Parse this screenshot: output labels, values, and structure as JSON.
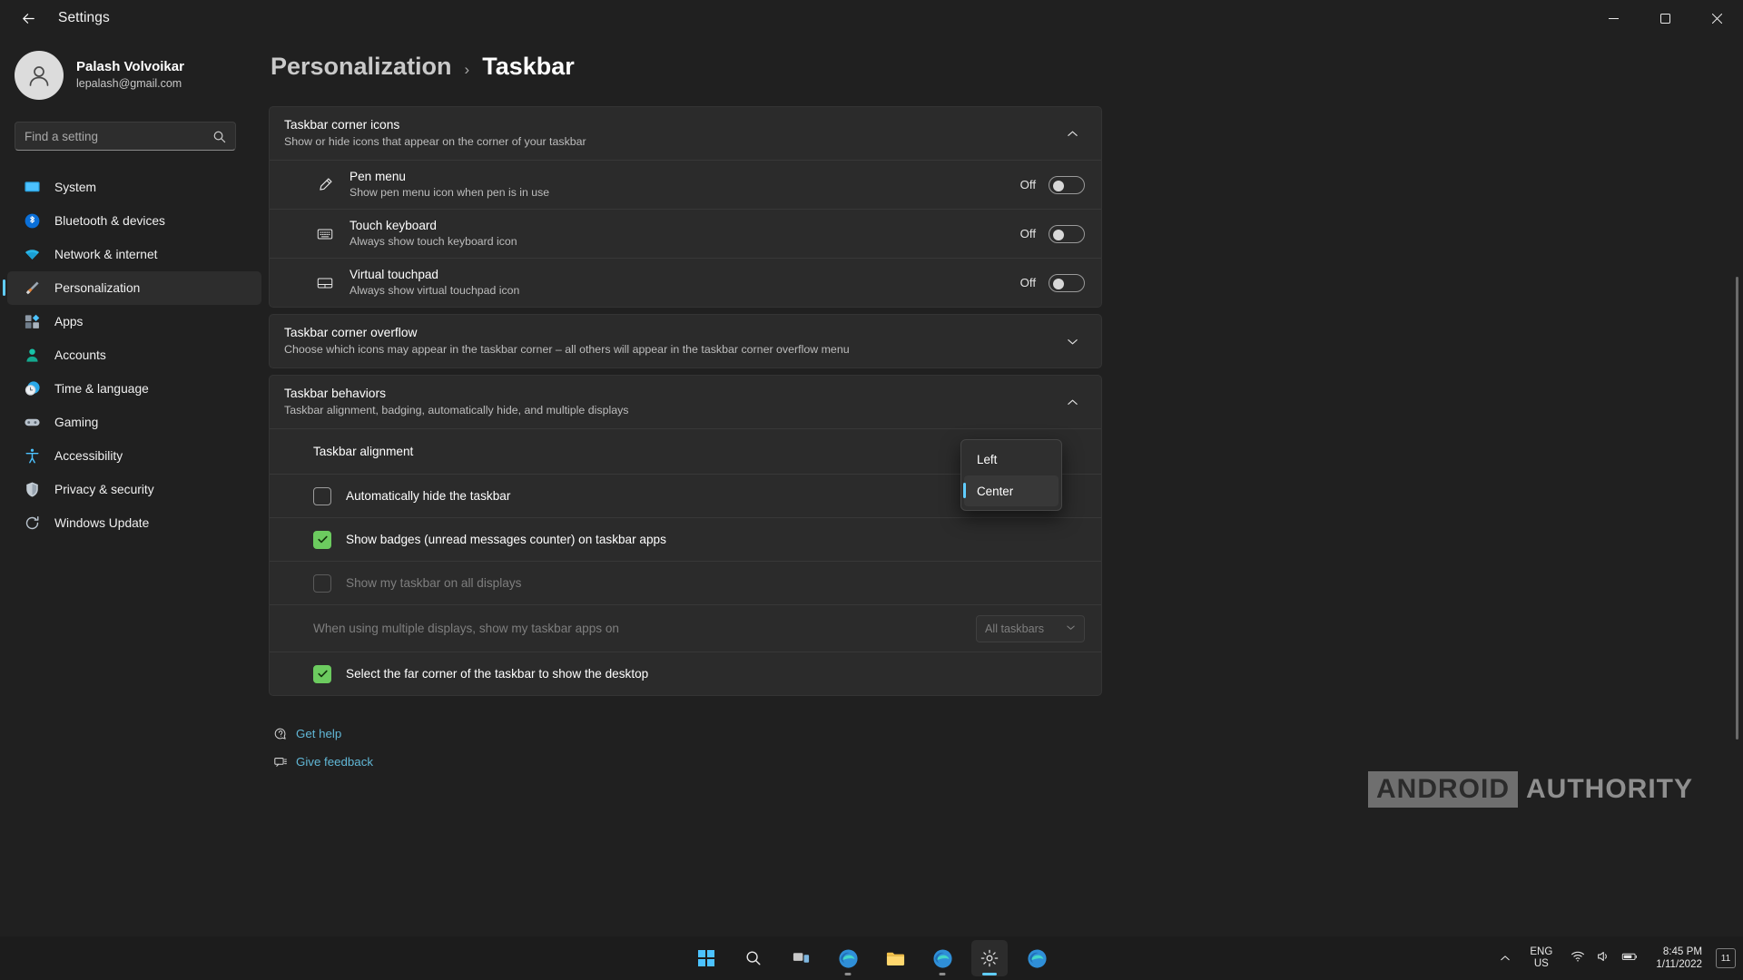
{
  "window": {
    "app_title": "Settings",
    "back_icon": "back-arrow-icon",
    "minimize": "minimize-icon",
    "maximize": "maximize-icon",
    "close": "close-icon"
  },
  "profile": {
    "name": "Palash Volvoikar",
    "email": "lepalash@gmail.com",
    "avatar_icon": "user-avatar-icon"
  },
  "search": {
    "placeholder": "Find a setting",
    "value": "",
    "icon": "search-icon"
  },
  "sidebar": {
    "items": [
      {
        "label": "System",
        "icon": "system-icon",
        "active": false
      },
      {
        "label": "Bluetooth & devices",
        "icon": "bluetooth-icon",
        "active": false
      },
      {
        "label": "Network & internet",
        "icon": "wifi-icon",
        "active": false
      },
      {
        "label": "Personalization",
        "icon": "paintbrush-icon",
        "active": true
      },
      {
        "label": "Apps",
        "icon": "apps-icon",
        "active": false
      },
      {
        "label": "Accounts",
        "icon": "accounts-icon",
        "active": false
      },
      {
        "label": "Time & language",
        "icon": "clock-icon",
        "active": false
      },
      {
        "label": "Gaming",
        "icon": "gamepad-icon",
        "active": false
      },
      {
        "label": "Accessibility",
        "icon": "accessibility-icon",
        "active": false
      },
      {
        "label": "Privacy & security",
        "icon": "shield-icon",
        "active": false
      },
      {
        "label": "Windows Update",
        "icon": "update-icon",
        "active": false
      }
    ]
  },
  "breadcrumb": {
    "parent": "Personalization",
    "separator": "›",
    "current": "Taskbar"
  },
  "cards": {
    "corner_icons": {
      "title": "Taskbar corner icons",
      "subtitle": "Show or hide icons that appear on the corner of your taskbar",
      "expanded": true,
      "chevron": "chevron-up-icon",
      "rows": [
        {
          "title": "Pen menu",
          "subtitle": "Show pen menu icon when pen is in use",
          "icon": "pen-icon",
          "state_label": "Off",
          "on": false
        },
        {
          "title": "Touch keyboard",
          "subtitle": "Always show touch keyboard icon",
          "icon": "keyboard-icon",
          "state_label": "Off",
          "on": false
        },
        {
          "title": "Virtual touchpad",
          "subtitle": "Always show virtual touchpad icon",
          "icon": "touchpad-icon",
          "state_label": "Off",
          "on": false
        }
      ]
    },
    "corner_overflow": {
      "title": "Taskbar corner overflow",
      "subtitle": "Choose which icons may appear in the taskbar corner – all others will appear in the taskbar corner overflow menu",
      "expanded": false,
      "chevron": "chevron-down-icon"
    },
    "behaviors": {
      "title": "Taskbar behaviors",
      "subtitle": "Taskbar alignment, badging, automatically hide, and multiple displays",
      "expanded": true,
      "chevron": "chevron-up-icon",
      "alignment": {
        "label": "Taskbar alignment",
        "selected": "Center",
        "options": [
          {
            "label": "Left",
            "selected": false
          },
          {
            "label": "Center",
            "selected": true
          }
        ]
      },
      "checkboxes": [
        {
          "label": "Automatically hide the taskbar",
          "checked": false,
          "disabled": false
        },
        {
          "label": "Show badges (unread messages counter) on taskbar apps",
          "checked": true,
          "disabled": false
        },
        {
          "label": "Show my taskbar on all displays",
          "checked": false,
          "disabled": true
        }
      ],
      "multi_display": {
        "label": "When using multiple displays, show my taskbar apps on",
        "value": "All taskbars",
        "disabled": true,
        "chevron": "chevron-down-icon"
      },
      "far_corner": {
        "label": "Select the far corner of the taskbar to show the desktop",
        "checked": true
      }
    }
  },
  "footer_links": [
    {
      "label": "Get help",
      "icon": "help-icon"
    },
    {
      "label": "Give feedback",
      "icon": "feedback-icon"
    }
  ],
  "watermark": {
    "first": "ANDROID",
    "second": "AUTHORITY"
  },
  "taskbar": {
    "apps": [
      {
        "icon": "start-icon",
        "state": "none"
      },
      {
        "icon": "search-icon",
        "state": "none"
      },
      {
        "icon": "task-view-icon",
        "state": "none"
      },
      {
        "icon": "edge-icon",
        "state": "open"
      },
      {
        "icon": "file-explorer-icon",
        "state": "none"
      },
      {
        "icon": "edge-beta-icon",
        "state": "open"
      },
      {
        "icon": "settings-icon",
        "state": "active"
      },
      {
        "icon": "store-icon",
        "state": "none"
      }
    ],
    "tray": {
      "chevron": "chevron-up-icon",
      "lang_line1": "ENG",
      "lang_line2": "US",
      "wifi_icon": "wifi-icon",
      "volume_icon": "volume-icon",
      "battery_icon": "battery-icon",
      "time": "8:45 PM",
      "date": "1/11/2022",
      "notification_count": "11"
    }
  },
  "colors": {
    "accent": "#60cdff",
    "checked_green": "#6ccb5f",
    "link": "#61b7d6",
    "card_bg": "#2b2b2b",
    "page_bg": "#202020"
  }
}
